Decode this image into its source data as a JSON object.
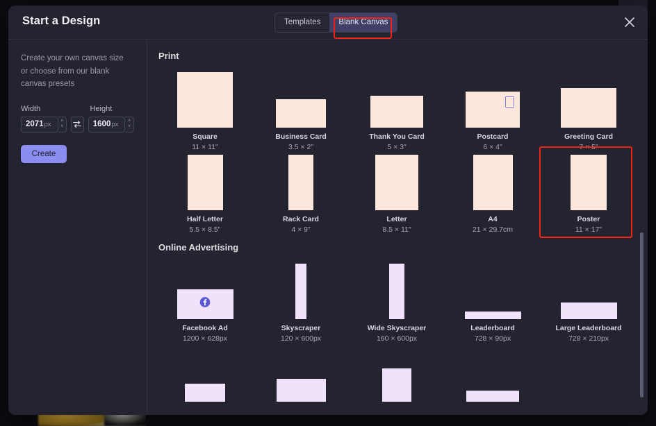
{
  "window": {
    "modal_title": "Start a Design",
    "close_icon": "close-icon"
  },
  "tabs": [
    {
      "label": "Templates",
      "active": false
    },
    {
      "label": "Blank Canvas",
      "active": true
    }
  ],
  "sidebar": {
    "description": "Create your own canvas size or choose from our blank canvas presets",
    "width_label": "Width",
    "height_label": "Height",
    "width_value": "2071",
    "width_unit": "px",
    "height_value": "1600",
    "height_unit": "px",
    "swap_icon": "swap-arrows-icon",
    "stepper_up": "˄",
    "stepper_down": "˅",
    "create_label": "Create"
  },
  "sections": [
    {
      "title": "Print",
      "accent": "#fde7dc",
      "items": [
        {
          "name": "Square",
          "size": "11 × 11\"",
          "w": 80,
          "h": 80,
          "icon": null
        },
        {
          "name": "Business Card",
          "size": "3.5 × 2\"",
          "w": 72,
          "h": 41,
          "icon": null
        },
        {
          "name": "Thank You Card",
          "size": "5 × 3\"",
          "w": 76,
          "h": 46,
          "icon": null
        },
        {
          "name": "Postcard",
          "size": "6 × 4\"",
          "w": 78,
          "h": 52,
          "icon": "stamp-icon"
        },
        {
          "name": "Greeting Card",
          "size": "7 × 5\"",
          "w": 80,
          "h": 57,
          "icon": null
        },
        {
          "name": "Half Letter",
          "size": "5.5 × 8.5\"",
          "w": 51,
          "h": 80,
          "icon": null
        },
        {
          "name": "Rack Card",
          "size": "4 × 9\"",
          "w": 36,
          "h": 80,
          "icon": null
        },
        {
          "name": "Letter",
          "size": "8.5 × 11\"",
          "w": 62,
          "h": 80,
          "icon": null
        },
        {
          "name": "A4",
          "size": "21 × 29.7cm",
          "w": 57,
          "h": 80,
          "icon": null
        },
        {
          "name": "Poster",
          "size": "11 × 17\"",
          "w": 52,
          "h": 80,
          "icon": null,
          "highlighted": true
        }
      ]
    },
    {
      "title": "Online Advertising",
      "accent": "#f0e2fb",
      "items": [
        {
          "name": "Facebook Ad",
          "size": "1200 × 628px",
          "w": 81,
          "h": 43,
          "icon": "facebook-icon"
        },
        {
          "name": "Skyscraper",
          "size": "120 × 600px",
          "w": 16,
          "h": 80,
          "icon": null
        },
        {
          "name": "Wide Skyscraper",
          "size": "160 × 600px",
          "w": 22,
          "h": 80,
          "icon": null
        },
        {
          "name": "Leaderboard",
          "size": "728 × 90px",
          "w": 81,
          "h": 11,
          "icon": null
        },
        {
          "name": "Large Leaderboard",
          "size": "728 × 210px",
          "w": 81,
          "h": 24,
          "icon": null
        }
      ]
    },
    {
      "title": "",
      "accent": "#f0e2fb",
      "partial": true,
      "items": [
        {
          "name": "",
          "size": "",
          "w": 58,
          "h": 26,
          "icon": null
        },
        {
          "name": "",
          "size": "",
          "w": 71,
          "h": 33,
          "icon": null
        },
        {
          "name": "",
          "size": "",
          "w": 42,
          "h": 48,
          "icon": null
        },
        {
          "name": "",
          "size": "",
          "w": 76,
          "h": 16,
          "icon": null
        }
      ]
    }
  ],
  "scrollbar": {
    "name": "vertical-scrollbar"
  },
  "colors": {
    "modal_bg": "#242431",
    "accent_button": "#8c8df0",
    "annotation_red": "#f42314",
    "tab_active_bg": "#3f3f68",
    "print_thumb": "#fde7dc",
    "ad_thumb": "#f0e2fb"
  }
}
